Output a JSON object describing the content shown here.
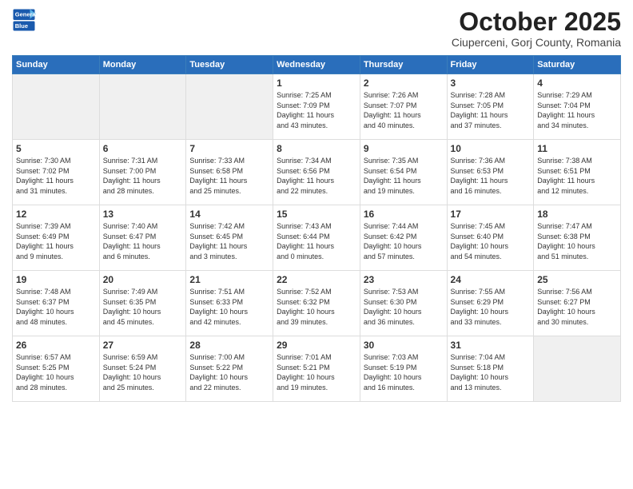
{
  "header": {
    "logo": {
      "general": "General",
      "blue": "Blue"
    },
    "title": "October 2025",
    "location": "Ciuperceni, Gorj County, Romania"
  },
  "weekdays": [
    "Sunday",
    "Monday",
    "Tuesday",
    "Wednesday",
    "Thursday",
    "Friday",
    "Saturday"
  ],
  "weeks": [
    [
      {
        "day": "",
        "info": ""
      },
      {
        "day": "",
        "info": ""
      },
      {
        "day": "",
        "info": ""
      },
      {
        "day": "1",
        "info": "Sunrise: 7:25 AM\nSunset: 7:09 PM\nDaylight: 11 hours\nand 43 minutes."
      },
      {
        "day": "2",
        "info": "Sunrise: 7:26 AM\nSunset: 7:07 PM\nDaylight: 11 hours\nand 40 minutes."
      },
      {
        "day": "3",
        "info": "Sunrise: 7:28 AM\nSunset: 7:05 PM\nDaylight: 11 hours\nand 37 minutes."
      },
      {
        "day": "4",
        "info": "Sunrise: 7:29 AM\nSunset: 7:04 PM\nDaylight: 11 hours\nand 34 minutes."
      }
    ],
    [
      {
        "day": "5",
        "info": "Sunrise: 7:30 AM\nSunset: 7:02 PM\nDaylight: 11 hours\nand 31 minutes."
      },
      {
        "day": "6",
        "info": "Sunrise: 7:31 AM\nSunset: 7:00 PM\nDaylight: 11 hours\nand 28 minutes."
      },
      {
        "day": "7",
        "info": "Sunrise: 7:33 AM\nSunset: 6:58 PM\nDaylight: 11 hours\nand 25 minutes."
      },
      {
        "day": "8",
        "info": "Sunrise: 7:34 AM\nSunset: 6:56 PM\nDaylight: 11 hours\nand 22 minutes."
      },
      {
        "day": "9",
        "info": "Sunrise: 7:35 AM\nSunset: 6:54 PM\nDaylight: 11 hours\nand 19 minutes."
      },
      {
        "day": "10",
        "info": "Sunrise: 7:36 AM\nSunset: 6:53 PM\nDaylight: 11 hours\nand 16 minutes."
      },
      {
        "day": "11",
        "info": "Sunrise: 7:38 AM\nSunset: 6:51 PM\nDaylight: 11 hours\nand 12 minutes."
      }
    ],
    [
      {
        "day": "12",
        "info": "Sunrise: 7:39 AM\nSunset: 6:49 PM\nDaylight: 11 hours\nand 9 minutes."
      },
      {
        "day": "13",
        "info": "Sunrise: 7:40 AM\nSunset: 6:47 PM\nDaylight: 11 hours\nand 6 minutes."
      },
      {
        "day": "14",
        "info": "Sunrise: 7:42 AM\nSunset: 6:45 PM\nDaylight: 11 hours\nand 3 minutes."
      },
      {
        "day": "15",
        "info": "Sunrise: 7:43 AM\nSunset: 6:44 PM\nDaylight: 11 hours\nand 0 minutes."
      },
      {
        "day": "16",
        "info": "Sunrise: 7:44 AM\nSunset: 6:42 PM\nDaylight: 10 hours\nand 57 minutes."
      },
      {
        "day": "17",
        "info": "Sunrise: 7:45 AM\nSunset: 6:40 PM\nDaylight: 10 hours\nand 54 minutes."
      },
      {
        "day": "18",
        "info": "Sunrise: 7:47 AM\nSunset: 6:38 PM\nDaylight: 10 hours\nand 51 minutes."
      }
    ],
    [
      {
        "day": "19",
        "info": "Sunrise: 7:48 AM\nSunset: 6:37 PM\nDaylight: 10 hours\nand 48 minutes."
      },
      {
        "day": "20",
        "info": "Sunrise: 7:49 AM\nSunset: 6:35 PM\nDaylight: 10 hours\nand 45 minutes."
      },
      {
        "day": "21",
        "info": "Sunrise: 7:51 AM\nSunset: 6:33 PM\nDaylight: 10 hours\nand 42 minutes."
      },
      {
        "day": "22",
        "info": "Sunrise: 7:52 AM\nSunset: 6:32 PM\nDaylight: 10 hours\nand 39 minutes."
      },
      {
        "day": "23",
        "info": "Sunrise: 7:53 AM\nSunset: 6:30 PM\nDaylight: 10 hours\nand 36 minutes."
      },
      {
        "day": "24",
        "info": "Sunrise: 7:55 AM\nSunset: 6:29 PM\nDaylight: 10 hours\nand 33 minutes."
      },
      {
        "day": "25",
        "info": "Sunrise: 7:56 AM\nSunset: 6:27 PM\nDaylight: 10 hours\nand 30 minutes."
      }
    ],
    [
      {
        "day": "26",
        "info": "Sunrise: 6:57 AM\nSunset: 5:25 PM\nDaylight: 10 hours\nand 28 minutes."
      },
      {
        "day": "27",
        "info": "Sunrise: 6:59 AM\nSunset: 5:24 PM\nDaylight: 10 hours\nand 25 minutes."
      },
      {
        "day": "28",
        "info": "Sunrise: 7:00 AM\nSunset: 5:22 PM\nDaylight: 10 hours\nand 22 minutes."
      },
      {
        "day": "29",
        "info": "Sunrise: 7:01 AM\nSunset: 5:21 PM\nDaylight: 10 hours\nand 19 minutes."
      },
      {
        "day": "30",
        "info": "Sunrise: 7:03 AM\nSunset: 5:19 PM\nDaylight: 10 hours\nand 16 minutes."
      },
      {
        "day": "31",
        "info": "Sunrise: 7:04 AM\nSunset: 5:18 PM\nDaylight: 10 hours\nand 13 minutes."
      },
      {
        "day": "",
        "info": ""
      }
    ]
  ]
}
